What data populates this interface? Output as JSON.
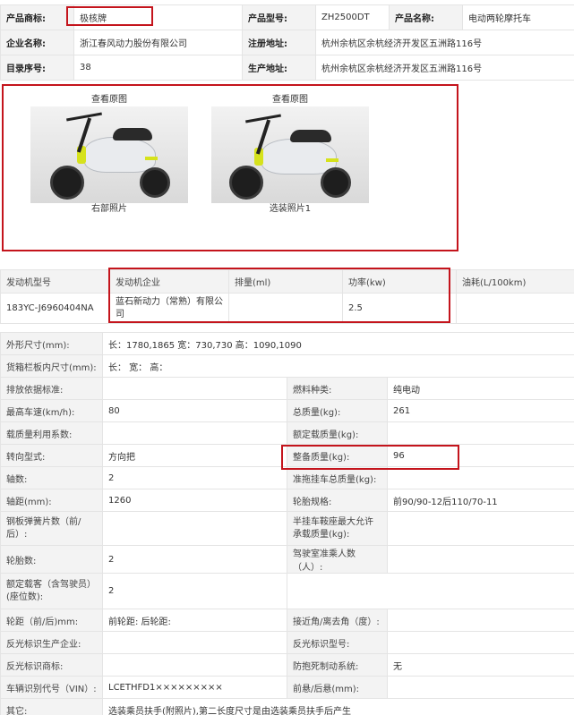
{
  "product_info": {
    "rows": [
      [
        {
          "label": "产品商标:",
          "value": "极核牌"
        },
        {
          "label": "产品型号:",
          "value": "ZH2500DT"
        },
        {
          "label": "产品名称:",
          "value": "电动两轮摩托车"
        }
      ],
      [
        {
          "label": "企业名称:",
          "value": "浙江春风动力股份有限公司"
        },
        {
          "label": "注册地址:",
          "value": "杭州余杭区余杭经济开发区五洲路116号"
        }
      ],
      [
        {
          "label": "目录序号:",
          "value": "38"
        },
        {
          "label": "生产地址:",
          "value": "杭州余杭区余杭经济开发区五洲路116号"
        }
      ]
    ]
  },
  "photos": [
    {
      "link": "查看原图",
      "caption": "右部照片"
    },
    {
      "link": "查看原图",
      "caption": "选装照片1"
    }
  ],
  "engine": {
    "headers": [
      "发动机型号",
      "发动机企业",
      "排量(ml)",
      "功率(kw)",
      "油耗(L/100km)"
    ],
    "row": [
      "183YC-J6960404NA",
      "蓝石新动力（常熟）有限公司",
      "",
      "2.5",
      ""
    ]
  },
  "specs": [
    {
      "l1": "外形尺寸(mm):",
      "v1": "长：1780,1865 宽：730,730 高：1090,1090"
    },
    {
      "l1": "货箱栏板内尺寸(mm):",
      "v1": "长：  宽：  高："
    },
    {
      "l1": "排放依据标准:",
      "v1": "",
      "l2": "燃料种类:",
      "v2": "纯电动"
    },
    {
      "l1": "最高车速(km/h):",
      "v1": "80",
      "l2": "总质量(kg):",
      "v2": "261"
    },
    {
      "l1": "载质量利用系数:",
      "v1": "",
      "l2": "额定载质量(kg):",
      "v2": ""
    },
    {
      "l1": "转向型式:",
      "v1": "方向把",
      "l2": "整备质量(kg):",
      "v2": "96"
    },
    {
      "l1": "轴数:",
      "v1": "2",
      "l2": "准拖挂车总质量(kg):",
      "v2": ""
    },
    {
      "l1": "轴距(mm):",
      "v1": "1260",
      "l2": "轮胎规格:",
      "v2": "前90/90-12后110/70-11"
    },
    {
      "l1": "钢板弹簧片数（前/后）:",
      "v1": "",
      "l2": "半挂车鞍座最大允许承载质量(kg):",
      "v2": ""
    },
    {
      "l1": "轮胎数:",
      "v1": "2",
      "l2": "驾驶室准乘人数（人）:",
      "v2": ""
    },
    {
      "l1": "额定载客（含驾驶员）(座位数):",
      "v1": "2"
    },
    {
      "l1": "轮距（前/后)mm:",
      "v1": "前轮距: 后轮距:",
      "l2": "接近角/离去角（度）:",
      "v2": ""
    },
    {
      "l1": "反光标识生产企业:",
      "v1": "",
      "l2": "反光标识型号:",
      "v2": ""
    },
    {
      "l1": "反光标识商标:",
      "v1": "",
      "l2": "防抱死制动系统:",
      "v2": "无"
    },
    {
      "l1": "车辆识别代号（VIN）:",
      "v1": "LCETHFD1×××××××××",
      "l2": "前悬/后悬(mm):",
      "v2": ""
    },
    {
      "l1": "其它:",
      "v1": "选装乘员扶手(附照片),第二长度尺寸是由选装乘员扶手后产生"
    }
  ],
  "colors": {
    "highlight_border": "#c4141c",
    "label_bg": "#f3f3f3",
    "grid": "#e4e4e4"
  }
}
